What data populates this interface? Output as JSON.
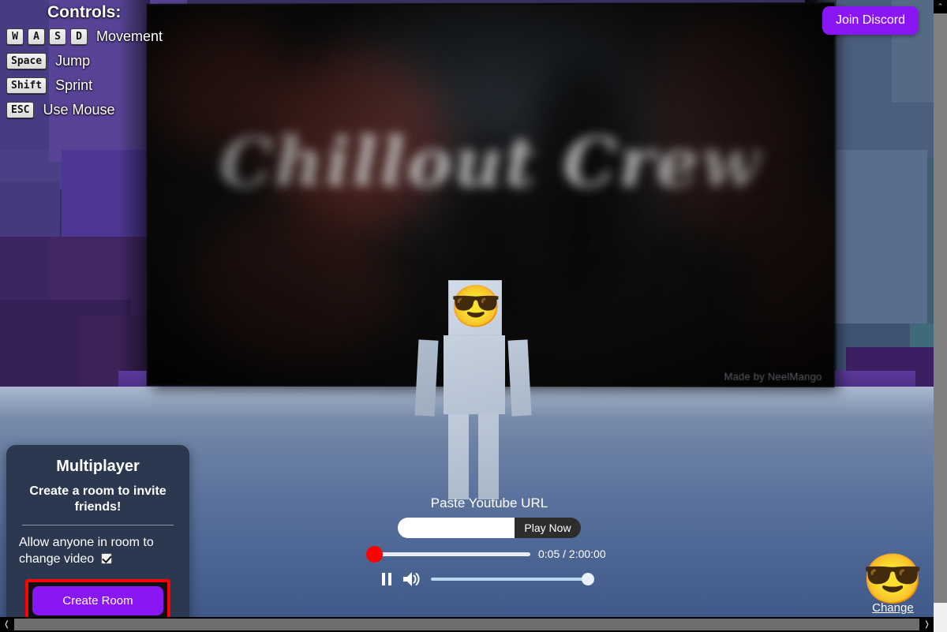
{
  "scene": {
    "video_title_text": "Chillout Crew",
    "watermark": "Made by NeelMango",
    "player_avatar_emoji": "😎"
  },
  "controls": {
    "title": "Controls:",
    "rows": [
      {
        "keys": [
          "W",
          "A",
          "S",
          "D"
        ],
        "label": "Movement"
      },
      {
        "keys": [
          "Space"
        ],
        "label": "Jump"
      },
      {
        "keys": [
          "Shift"
        ],
        "label": "Sprint"
      },
      {
        "keys": [
          "ESC"
        ],
        "label": "Use Mouse"
      }
    ]
  },
  "discord": {
    "label": "Join Discord",
    "color": "#8b16f5"
  },
  "multiplayer": {
    "title": "Multiplayer",
    "subtitle": "Create a room to invite friends!",
    "checkbox_label": "Allow anyone in room to change video",
    "checkbox_checked": "true",
    "create_button": "Create Room",
    "create_button_color": "#8b16f5",
    "highlight_color": "#ff0000",
    "panel_color": "#2b3850"
  },
  "player_ui": {
    "url_label": "Paste Youtube URL",
    "url_value": "",
    "url_placeholder": "",
    "play_button": "Play Now",
    "current_time": "0:05",
    "total_time": "2:00:00",
    "time_display": "0:05 / 2:00:00",
    "seek_percent": 0,
    "volume_percent": 100,
    "playback_state": "playing",
    "pause_icon": "pause-icon",
    "volume_icon": "volume-on-icon",
    "seek_thumb_color": "#ff0000"
  },
  "avatar": {
    "emoji": "😎",
    "change_label": "Change"
  },
  "scrollbars": {
    "vertical_up_arrow": "⌃",
    "vertical_down_arrow": "⌄",
    "horizontal_left_arrow": "❬",
    "horizontal_right_arrow": "❭"
  }
}
